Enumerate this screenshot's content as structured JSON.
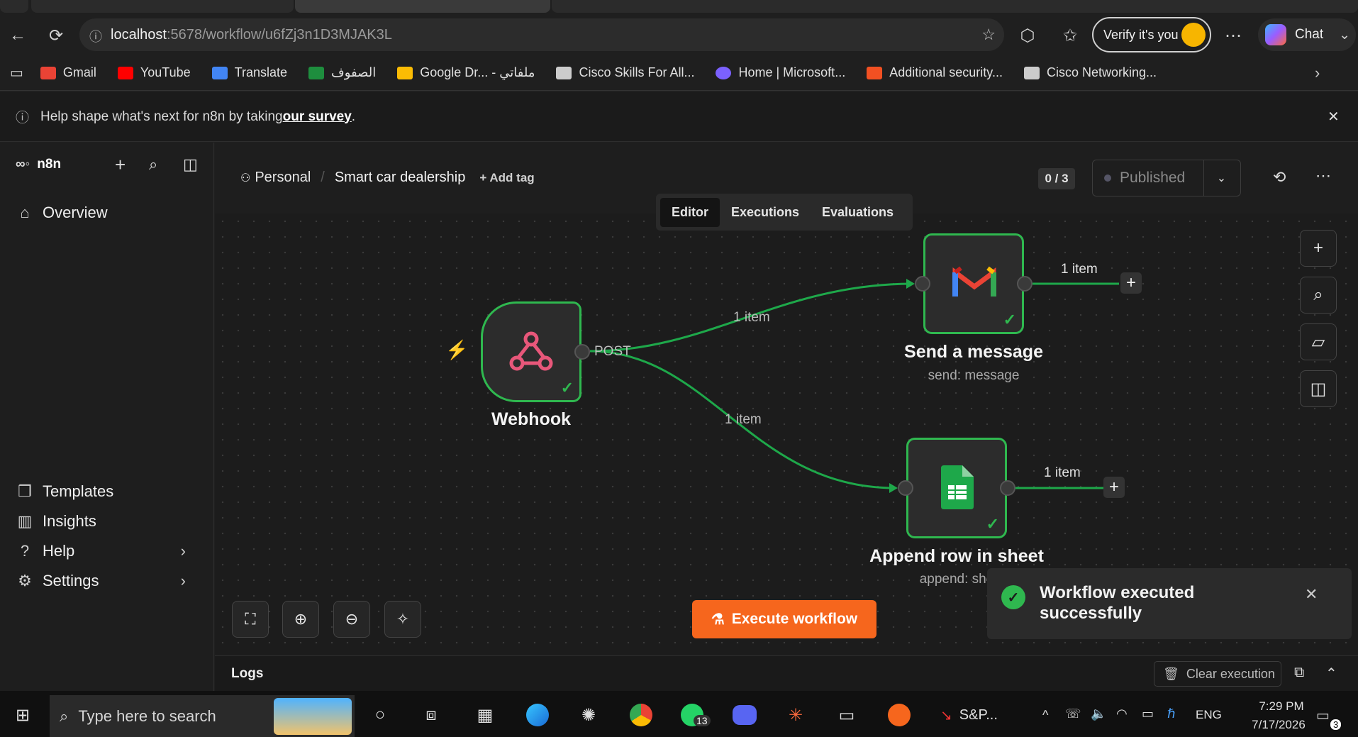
{
  "browser": {
    "url_host": "localhost",
    "url_path": ":5678/workflow/u6fZj3n1D3MJAK3L",
    "verify_label": "Verify it's you",
    "chat_label": "Chat",
    "more_icon": "more-dots-icon",
    "bookmarks": [
      {
        "label": "Gmail",
        "color": "#ea4335"
      },
      {
        "label": "YouTube",
        "color": "#ff0000"
      },
      {
        "label": "Translate",
        "color": "#4285f4"
      },
      {
        "label": "الصفوف",
        "color": "#1e8e3e"
      },
      {
        "label": "Google Dr... - ملفاتي",
        "color": "#fbbc04"
      },
      {
        "label": "Cisco Skills For All...",
        "color": "#cccccc"
      },
      {
        "label": "Home | Microsoft...",
        "color": "#7b61ff"
      },
      {
        "label": "Additional security...",
        "color": "#f25022"
      },
      {
        "label": "Cisco Networking...",
        "color": "#cccccc"
      }
    ]
  },
  "banner": {
    "text_before": "Help shape what's next for n8n by taking ",
    "link": "our survey",
    "text_after": "."
  },
  "sidebar": {
    "brand": "n8n",
    "overview": "Overview",
    "templates": "Templates",
    "insights": "Insights",
    "help": "Help",
    "settings": "Settings"
  },
  "header": {
    "project": "Personal",
    "workflow_name": "Smart car dealership",
    "add_tag": "+ Add tag",
    "counter": "0 / 3",
    "published": "Published"
  },
  "view_tabs": [
    "Editor",
    "Executions",
    "Evaluations"
  ],
  "nodes": {
    "webhook": {
      "title": "Webhook",
      "method": "POST"
    },
    "gmail": {
      "title": "Send a message",
      "subtitle": "send: message"
    },
    "sheets": {
      "title": "Append row in sheet",
      "subtitle": "append: she"
    }
  },
  "edges": {
    "to_gmail": "1 item",
    "to_sheets": "1 item",
    "gmail_out": "1 item",
    "sheets_out": "1 item"
  },
  "execute_label": "Execute workflow",
  "toast": {
    "message": "Workflow executed successfully"
  },
  "logs": {
    "label": "Logs",
    "clear": "Clear execution"
  },
  "taskbar": {
    "search_placeholder": "Type here to search",
    "whatsapp_badge": "13",
    "app_label": "S&P...",
    "lang": "ENG",
    "time": "7:29 PM",
    "date": "7/17/2026",
    "notif_count": "3"
  },
  "colors": {
    "accent": "#f6661d",
    "success": "#2fb84f"
  }
}
